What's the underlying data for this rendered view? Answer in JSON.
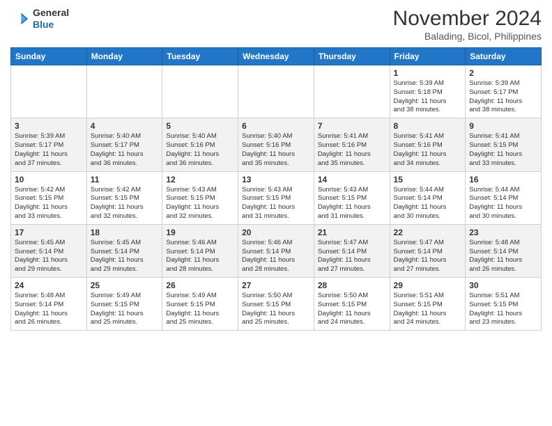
{
  "header": {
    "logo_line1": "General",
    "logo_line2": "Blue",
    "month_title": "November 2024",
    "location": "Balading, Bicol, Philippines"
  },
  "weekdays": [
    "Sunday",
    "Monday",
    "Tuesday",
    "Wednesday",
    "Thursday",
    "Friday",
    "Saturday"
  ],
  "weeks": [
    [
      {
        "day": "",
        "info": ""
      },
      {
        "day": "",
        "info": ""
      },
      {
        "day": "",
        "info": ""
      },
      {
        "day": "",
        "info": ""
      },
      {
        "day": "",
        "info": ""
      },
      {
        "day": "1",
        "info": "Sunrise: 5:39 AM\nSunset: 5:18 PM\nDaylight: 11 hours\nand 38 minutes."
      },
      {
        "day": "2",
        "info": "Sunrise: 5:39 AM\nSunset: 5:17 PM\nDaylight: 11 hours\nand 38 minutes."
      }
    ],
    [
      {
        "day": "3",
        "info": "Sunrise: 5:39 AM\nSunset: 5:17 PM\nDaylight: 11 hours\nand 37 minutes."
      },
      {
        "day": "4",
        "info": "Sunrise: 5:40 AM\nSunset: 5:17 PM\nDaylight: 11 hours\nand 36 minutes."
      },
      {
        "day": "5",
        "info": "Sunrise: 5:40 AM\nSunset: 5:16 PM\nDaylight: 11 hours\nand 36 minutes."
      },
      {
        "day": "6",
        "info": "Sunrise: 5:40 AM\nSunset: 5:16 PM\nDaylight: 11 hours\nand 35 minutes."
      },
      {
        "day": "7",
        "info": "Sunrise: 5:41 AM\nSunset: 5:16 PM\nDaylight: 11 hours\nand 35 minutes."
      },
      {
        "day": "8",
        "info": "Sunrise: 5:41 AM\nSunset: 5:16 PM\nDaylight: 11 hours\nand 34 minutes."
      },
      {
        "day": "9",
        "info": "Sunrise: 5:41 AM\nSunset: 5:15 PM\nDaylight: 11 hours\nand 33 minutes."
      }
    ],
    [
      {
        "day": "10",
        "info": "Sunrise: 5:42 AM\nSunset: 5:15 PM\nDaylight: 11 hours\nand 33 minutes."
      },
      {
        "day": "11",
        "info": "Sunrise: 5:42 AM\nSunset: 5:15 PM\nDaylight: 11 hours\nand 32 minutes."
      },
      {
        "day": "12",
        "info": "Sunrise: 5:43 AM\nSunset: 5:15 PM\nDaylight: 11 hours\nand 32 minutes."
      },
      {
        "day": "13",
        "info": "Sunrise: 5:43 AM\nSunset: 5:15 PM\nDaylight: 11 hours\nand 31 minutes."
      },
      {
        "day": "14",
        "info": "Sunrise: 5:43 AM\nSunset: 5:15 PM\nDaylight: 11 hours\nand 31 minutes."
      },
      {
        "day": "15",
        "info": "Sunrise: 5:44 AM\nSunset: 5:14 PM\nDaylight: 11 hours\nand 30 minutes."
      },
      {
        "day": "16",
        "info": "Sunrise: 5:44 AM\nSunset: 5:14 PM\nDaylight: 11 hours\nand 30 minutes."
      }
    ],
    [
      {
        "day": "17",
        "info": "Sunrise: 5:45 AM\nSunset: 5:14 PM\nDaylight: 11 hours\nand 29 minutes."
      },
      {
        "day": "18",
        "info": "Sunrise: 5:45 AM\nSunset: 5:14 PM\nDaylight: 11 hours\nand 29 minutes."
      },
      {
        "day": "19",
        "info": "Sunrise: 5:46 AM\nSunset: 5:14 PM\nDaylight: 11 hours\nand 28 minutes."
      },
      {
        "day": "20",
        "info": "Sunrise: 5:46 AM\nSunset: 5:14 PM\nDaylight: 11 hours\nand 28 minutes."
      },
      {
        "day": "21",
        "info": "Sunrise: 5:47 AM\nSunset: 5:14 PM\nDaylight: 11 hours\nand 27 minutes."
      },
      {
        "day": "22",
        "info": "Sunrise: 5:47 AM\nSunset: 5:14 PM\nDaylight: 11 hours\nand 27 minutes."
      },
      {
        "day": "23",
        "info": "Sunrise: 5:48 AM\nSunset: 5:14 PM\nDaylight: 11 hours\nand 26 minutes."
      }
    ],
    [
      {
        "day": "24",
        "info": "Sunrise: 5:48 AM\nSunset: 5:14 PM\nDaylight: 11 hours\nand 26 minutes."
      },
      {
        "day": "25",
        "info": "Sunrise: 5:49 AM\nSunset: 5:15 PM\nDaylight: 11 hours\nand 25 minutes."
      },
      {
        "day": "26",
        "info": "Sunrise: 5:49 AM\nSunset: 5:15 PM\nDaylight: 11 hours\nand 25 minutes."
      },
      {
        "day": "27",
        "info": "Sunrise: 5:50 AM\nSunset: 5:15 PM\nDaylight: 11 hours\nand 25 minutes."
      },
      {
        "day": "28",
        "info": "Sunrise: 5:50 AM\nSunset: 5:15 PM\nDaylight: 11 hours\nand 24 minutes."
      },
      {
        "day": "29",
        "info": "Sunrise: 5:51 AM\nSunset: 5:15 PM\nDaylight: 11 hours\nand 24 minutes."
      },
      {
        "day": "30",
        "info": "Sunrise: 5:51 AM\nSunset: 5:15 PM\nDaylight: 11 hours\nand 23 minutes."
      }
    ]
  ]
}
